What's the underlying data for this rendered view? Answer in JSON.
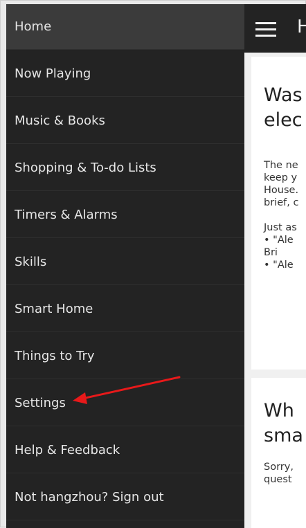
{
  "sidebar": {
    "items": [
      {
        "label": "Home",
        "active": true
      },
      {
        "label": "Now Playing"
      },
      {
        "label": "Music & Books"
      },
      {
        "label": "Shopping & To-do Lists"
      },
      {
        "label": "Timers & Alarms"
      },
      {
        "label": "Skills"
      },
      {
        "label": "Smart Home"
      },
      {
        "label": "Things to Try"
      },
      {
        "label": "Settings"
      },
      {
        "label": "Help & Feedback"
      },
      {
        "label": "Not hangzhou? Sign out"
      }
    ]
  },
  "header": {
    "title": "H",
    "menu_icon": "hamburger-menu-icon"
  },
  "main": {
    "card1": {
      "headline": [
        "Was",
        "elec"
      ],
      "paragraph": [
        "The ne",
        "keep y",
        "House.",
        "brief, c"
      ],
      "prompt": "Just as",
      "bullets": [
        "•  \"Ale",
        "    Bri",
        "•  \"Ale"
      ]
    },
    "card2": {
      "headline": [
        "Wh",
        "sma"
      ],
      "paragraph": [
        "Sorry,",
        "quest"
      ]
    }
  },
  "annotation": {
    "arrow_color": "#e8191a",
    "target": "Settings"
  },
  "colors": {
    "sidebar_bg": "#232323",
    "sidebar_active_bg": "#3b3b3b",
    "sidebar_text": "#e6e6e6",
    "content_bg": "#f0f0f0"
  }
}
